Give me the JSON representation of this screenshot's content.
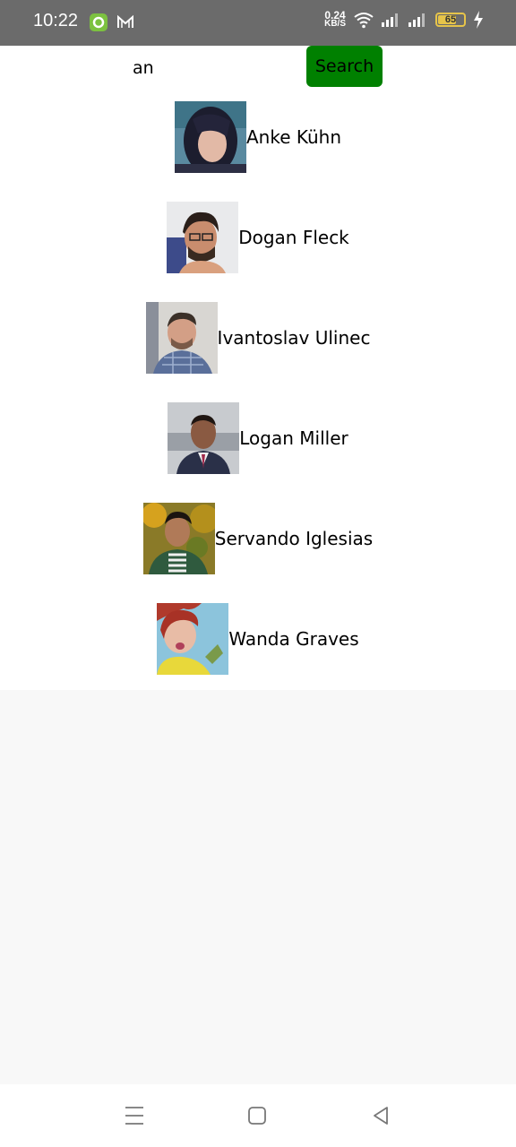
{
  "status_bar": {
    "time": "10:22",
    "net_speed_value": "0.24",
    "net_speed_unit": "KB/S",
    "battery_level": "65",
    "battery_fraction": 0.65
  },
  "search": {
    "query": "an",
    "button_label": "Search"
  },
  "results": [
    {
      "name": "Anke Kühn",
      "avatar": "avatar-anke"
    },
    {
      "name": "Dogan Fleck",
      "avatar": "avatar-dogan"
    },
    {
      "name": "Ivantoslav Ulinec",
      "avatar": "avatar-ivantoslav"
    },
    {
      "name": "Logan Miller",
      "avatar": "avatar-logan"
    },
    {
      "name": "Servando Iglesias",
      "avatar": "avatar-servando"
    },
    {
      "name": "Wanda Graves",
      "avatar": "avatar-wanda"
    }
  ],
  "nav": {
    "icons": [
      "menu-icon",
      "home-icon",
      "back-icon"
    ]
  },
  "colors": {
    "accent": "#008000",
    "status_bar": "#6b6b6b",
    "background": "#f8f8f8"
  }
}
